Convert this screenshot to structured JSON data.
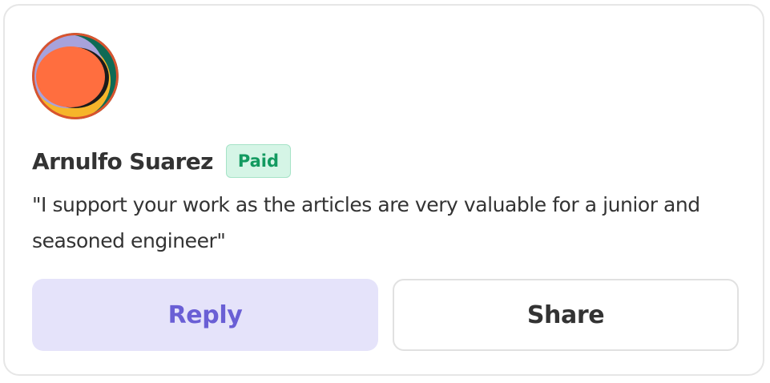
{
  "comment": {
    "author_name": "Arnulfo Suarez",
    "badge": "Paid",
    "message": "\"I support your work as the articles are very valuable for a junior and seasoned engineer\"",
    "avatar_icon": "abstract-circle-avatar"
  },
  "actions": {
    "reply_label": "Reply",
    "share_label": "Share"
  },
  "colors": {
    "badge_bg": "#d5f5e6",
    "badge_text": "#129a60",
    "reply_bg": "#e5e3fa",
    "reply_text": "#6a5fd5",
    "text": "#333333"
  }
}
